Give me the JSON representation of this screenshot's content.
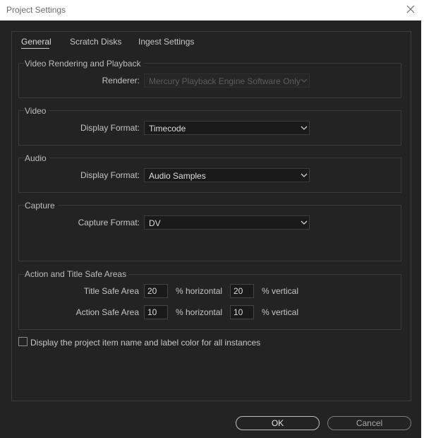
{
  "window": {
    "title": "Project Settings"
  },
  "tabs": [
    {
      "label": "General",
      "active": true
    },
    {
      "label": "Scratch Disks",
      "active": false
    },
    {
      "label": "Ingest Settings",
      "active": false
    }
  ],
  "video_rendering": {
    "title": "Video Rendering and Playback",
    "renderer_label": "Renderer:",
    "renderer_value": "Mercury Playback Engine Software Only"
  },
  "video": {
    "title": "Video",
    "display_format_label": "Display Format:",
    "display_format_value": "Timecode"
  },
  "audio": {
    "title": "Audio",
    "display_format_label": "Display Format:",
    "display_format_value": "Audio Samples"
  },
  "capture": {
    "title": "Capture",
    "capture_format_label": "Capture Format:",
    "capture_format_value": "DV"
  },
  "safe_areas": {
    "title": "Action and Title Safe Areas",
    "title_safe_label": "Title Safe Area",
    "title_safe_h": "20",
    "title_safe_v": "20",
    "action_safe_label": "Action Safe Area",
    "action_safe_h": "10",
    "action_safe_v": "10",
    "horizontal_unit": "% horizontal",
    "vertical_unit": "% vertical"
  },
  "display_label_checkbox": {
    "label": "Display the project item name and label color for all instances",
    "checked": false
  },
  "buttons": {
    "ok": "OK",
    "cancel": "Cancel"
  },
  "colors": {
    "background": "#232323",
    "field": "#1a1a1a",
    "titlebar": "#ffffff"
  }
}
